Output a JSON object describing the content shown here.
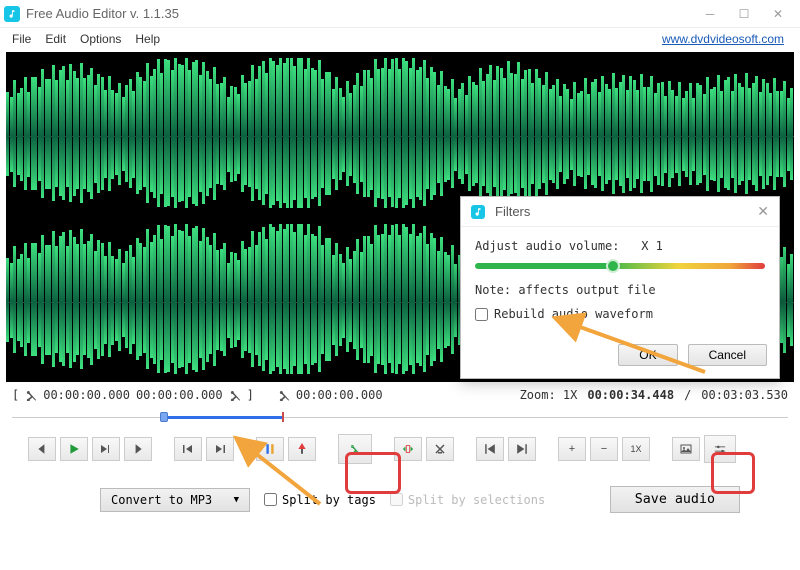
{
  "window": {
    "title": "Free Audio Editor v. 1.1.35"
  },
  "menu": {
    "file": "File",
    "edit": "Edit",
    "options": "Options",
    "help": "Help"
  },
  "link": "www.dvdvideosoft.com",
  "status": {
    "sel_start": "00:00:00.000",
    "sel_end": "00:00:00.000",
    "pos": "00:00:00.000",
    "zoom_label": "Zoom: 1X",
    "current": "00:00:34.448",
    "sep": "/",
    "total": "00:03:03.530"
  },
  "dialog": {
    "title": "Filters",
    "volume_label": "Adjust audio volume:",
    "volume_value": "X 1",
    "note": "Note: affects output file",
    "rebuild": "Rebuild audio waveform",
    "ok": "OK",
    "cancel": "Cancel"
  },
  "toolbar": {
    "one_x": "1X"
  },
  "footer": {
    "convert": "Convert to MP3",
    "split_tags": "Split by tags",
    "split_sel": "Split by selections",
    "save": "Save audio"
  }
}
